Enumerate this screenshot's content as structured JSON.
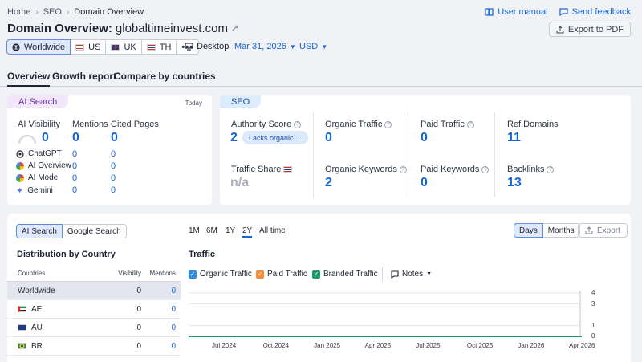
{
  "breadcrumb": [
    "Home",
    "SEO",
    "Domain Overview"
  ],
  "top_links": {
    "manual": "User manual",
    "feedback": "Send feedback"
  },
  "title": {
    "prefix": "Domain Overview:",
    "domain": "globaltimeinvest.com"
  },
  "export_pdf": "Export to PDF",
  "databases": [
    {
      "label": "Worldwide"
    },
    {
      "label": "US"
    },
    {
      "label": "UK"
    },
    {
      "label": "TH"
    }
  ],
  "more_label": "•••",
  "device": "Desktop",
  "date": "Mar 31, 2026",
  "currency": "USD",
  "tabs": [
    "Overview",
    "Growth report",
    "Compare by countries"
  ],
  "ai_card": {
    "tag": "AI Search",
    "period": "Today",
    "headers": {
      "visibility": "AI Visibility",
      "mentions": "Mentions",
      "cited": "Cited Pages"
    },
    "totals": {
      "visibility": "0",
      "mentions": "0",
      "cited": "0"
    },
    "engines": [
      {
        "name": "ChatGPT",
        "mentions": "0",
        "cited": "0"
      },
      {
        "name": "AI Overview",
        "mentions": "0",
        "cited": "0"
      },
      {
        "name": "AI Mode",
        "mentions": "0",
        "cited": "0"
      },
      {
        "name": "Gemini",
        "mentions": "0",
        "cited": "0"
      }
    ]
  },
  "seo_card": {
    "tag": "SEO",
    "metrics": {
      "authority": {
        "label": "Authority Score",
        "value": "2",
        "badge": "Lacks organic ..."
      },
      "organic_traffic": {
        "label": "Organic Traffic",
        "value": "0"
      },
      "paid_traffic": {
        "label": "Paid Traffic",
        "value": "0"
      },
      "ref_domains": {
        "label": "Ref.Domains",
        "value": "11"
      },
      "traffic_share": {
        "label": "Traffic Share",
        "value": "n/a"
      },
      "organic_keywords": {
        "label": "Organic Keywords",
        "value": "2"
      },
      "paid_keywords": {
        "label": "Paid Keywords",
        "value": "0"
      },
      "backlinks": {
        "label": "Backlinks",
        "value": "13"
      }
    }
  },
  "lower": {
    "search_toggle": [
      "AI Search",
      "Google Search"
    ],
    "periods": [
      "1M",
      "6M",
      "1Y",
      "2Y",
      "All time"
    ],
    "period_selected": "2Y",
    "granularity": [
      "Days",
      "Months"
    ],
    "export": "Export",
    "distribution": {
      "title": "Distribution by Country",
      "headers": {
        "country": "Countries",
        "visibility": "Visibility",
        "mentions": "Mentions"
      },
      "rows": [
        {
          "country": "Worldwide",
          "visibility": "0",
          "mentions": "0"
        },
        {
          "country": "AE",
          "visibility": "0",
          "mentions": "0"
        },
        {
          "country": "AU",
          "visibility": "0",
          "mentions": "0"
        },
        {
          "country": "BR",
          "visibility": "0",
          "mentions": "0"
        }
      ]
    },
    "traffic": {
      "title": "Traffic",
      "legend": [
        {
          "label": "Organic Traffic",
          "color": "#2e8ce6"
        },
        {
          "label": "Paid Traffic",
          "color": "#f28c38"
        },
        {
          "label": "Branded Traffic",
          "color": "#189a6b"
        }
      ],
      "notes": "Notes"
    }
  },
  "chart_data": {
    "type": "line",
    "title": "Traffic",
    "x": [
      "Jul 2024",
      "Oct 2024",
      "Jan 2025",
      "Apr 2025",
      "Jul 2025",
      "Oct 2025",
      "Jan 2026",
      "Apr 2026"
    ],
    "y_ticks": [
      0,
      1,
      3,
      4
    ],
    "ylim": [
      0,
      4
    ],
    "series": [
      {
        "name": "Organic Traffic",
        "values": [
          0,
          0,
          0,
          0,
          0,
          0,
          0,
          0
        ]
      },
      {
        "name": "Paid Traffic",
        "values": [
          0,
          0,
          0,
          0,
          0,
          0,
          0,
          0
        ]
      },
      {
        "name": "Branded Traffic",
        "values": [
          0,
          0,
          0,
          0,
          0,
          0,
          0,
          0
        ]
      }
    ]
  }
}
